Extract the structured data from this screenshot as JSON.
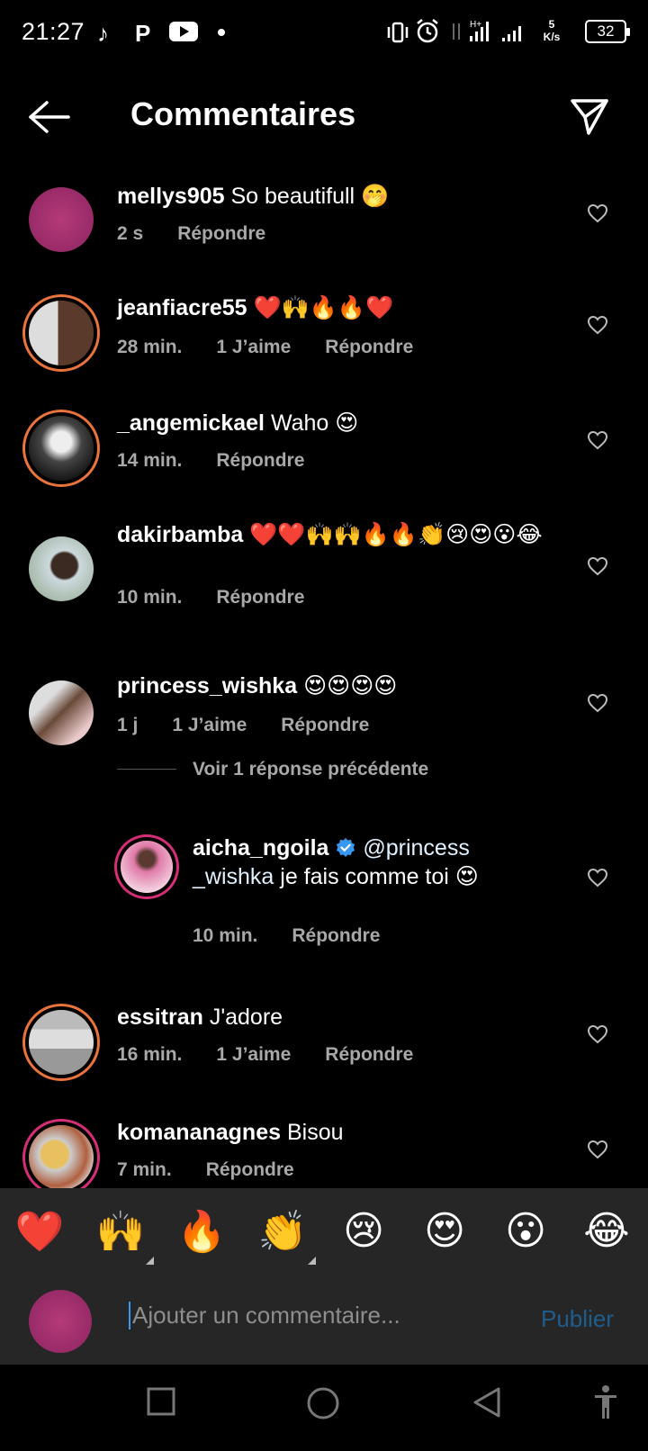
{
  "status_bar": {
    "time": "21:27",
    "net_speed_value": "5",
    "net_speed_unit": "K/s",
    "battery": "32"
  },
  "header": {
    "title": "Commentaires"
  },
  "comments": [
    {
      "username": "mellys905",
      "text": " So beautifull 🤭",
      "time": "2 s",
      "likes": "",
      "reply": "Répondre"
    },
    {
      "username": "jeanfiacre55",
      "text": " ❤️🙌🔥🔥❤️",
      "time": "28 min.",
      "likes": "1 J’aime",
      "reply": "Répondre"
    },
    {
      "username": "_angemickael",
      "text": " Waho 😍",
      "time": "14 min.",
      "likes": "",
      "reply": "Répondre"
    },
    {
      "username": "dakirbamba",
      "text": " ❤️❤️🙌🙌🔥🔥👏😢😍😮😂",
      "time": "10 min.",
      "likes": "",
      "reply": "Répondre"
    },
    {
      "username": "princess_wishka",
      "text": " 😍😍😍😍",
      "time": "1 j",
      "likes": "1 J’aime",
      "reply": "Répondre"
    },
    {
      "username": "essitran",
      "text": " J'adore",
      "time": "16 min.",
      "likes": "1 J’aime",
      "reply": "Répondre"
    },
    {
      "username": "komananagnes",
      "text": " Bisou",
      "time": "7 min.",
      "likes": "",
      "reply": "Répondre"
    }
  ],
  "replies_toggle": "Voir 1 réponse précédente",
  "reply": {
    "username": "aicha_ngoila",
    "mention": "@princess _wishka",
    "text": " je fais comme toi 😍",
    "time": "10 min.",
    "reply": "Répondre"
  },
  "emoji_bar": [
    "❤️",
    "🙌",
    "🔥",
    "👏",
    "😢",
    "😍",
    "😮",
    "😂"
  ],
  "compose": {
    "placeholder": "Ajouter un commentaire...",
    "publish_label": "Publier"
  },
  "colors": {
    "background": "#000000",
    "panel": "#262626",
    "secondary_text": "#a8a8a8",
    "accent_blue": "#3897f0",
    "publish_disabled": "#1f5d8c",
    "story_ring": "#d62e76"
  }
}
